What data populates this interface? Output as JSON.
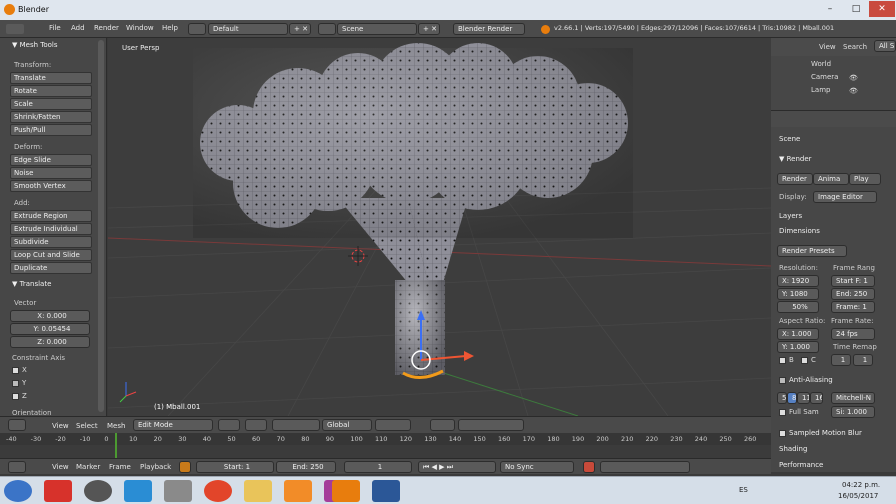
{
  "window": {
    "title": "Blender"
  },
  "menubar": {
    "items": [
      "File",
      "Add",
      "Render",
      "Window",
      "Help"
    ],
    "layout": "Default",
    "scene": "Scene",
    "engine": "Blender Render",
    "stats": "v2.66.1 | Verts:197/5490 | Edges:297/12096 | Faces:107/6614 | Tris:10982 | Mball.001"
  },
  "toolshelf": {
    "mesh_tools": "Mesh Tools",
    "transform_label": "Transform:",
    "transform": [
      "Translate",
      "Rotate",
      "Scale",
      "Shrink/Fatten",
      "Push/Pull"
    ],
    "deform_label": "Deform:",
    "deform": [
      "Edge Slide",
      "Noise",
      "Smooth Vertex"
    ],
    "add_label": "Add:",
    "add": [
      "Extrude Region",
      "Extrude Individual",
      "Subdivide",
      "Loop Cut and Slide",
      "Duplicate"
    ],
    "operator": "Translate",
    "vector_label": "Vector",
    "vector": [
      "X: 0.000",
      "Y: 0.05454",
      "Z: 0.000"
    ],
    "constraint_label": "Constraint Axis",
    "axes": [
      "X",
      "Y",
      "Z"
    ],
    "orientation_label": "Orientation"
  },
  "viewport": {
    "view_name": "User Persp",
    "object_label": "(1) Mball.001"
  },
  "view_header": {
    "menus": [
      "View",
      "Select",
      "Mesh"
    ],
    "mode": "Edit Mode",
    "orientation": "Global"
  },
  "outliner": {
    "menus": [
      "View",
      "Search",
      "All S"
    ],
    "items": [
      "World",
      "Camera",
      "Lamp"
    ]
  },
  "properties": {
    "scene": "Scene",
    "render": "Render",
    "buttons": [
      "Render",
      "Anima",
      "Play"
    ],
    "display_label": "Display:",
    "display": "Image Editor",
    "layers": "Layers",
    "dimensions": "Dimensions",
    "presets": "Render Presets",
    "resolution": "Resolution:",
    "res_x": "X: 1920",
    "res_y": "Y: 1080",
    "res_pct": "50%",
    "frame_range": "Frame Rang",
    "start": "Start F: 1",
    "end": "End: 250",
    "frame": "Frame: 1",
    "aspect": "Aspect Ratio:",
    "asp_x": "X: 1.000",
    "asp_y": "Y: 1.000",
    "b": "B",
    "c": "C",
    "frame_rate": "Frame Rate:",
    "fps": "24 fps",
    "time_remap": "Time Remap",
    "remap_a": "1",
    "remap_b": "1",
    "aa": "Anti-Aliasing",
    "aa_samples": [
      "5",
      "8",
      "11",
      "16"
    ],
    "filter": "Mitchell-N",
    "full": "Full Sam",
    "size": "Si: 1.000",
    "motion": "Sampled Motion Blur",
    "shading": "Shading",
    "performance": "Performance"
  },
  "timeline": {
    "ticks": [
      "-40",
      "-30",
      "-20",
      "-10",
      "0",
      "10",
      "20",
      "30",
      "40",
      "50",
      "60",
      "70",
      "80",
      "90",
      "100",
      "110",
      "120",
      "130",
      "140",
      "150",
      "160",
      "170",
      "180",
      "190",
      "200",
      "210",
      "220",
      "230",
      "240",
      "250",
      "260"
    ],
    "menus": [
      "View",
      "Marker",
      "Frame",
      "Playback"
    ],
    "start": "Start: 1",
    "end": "End: 250",
    "current": "1",
    "sync": "No Sync"
  },
  "taskbar": {
    "lang": "ES",
    "time": "04:22 p.m.",
    "date": "16/05/2017"
  }
}
